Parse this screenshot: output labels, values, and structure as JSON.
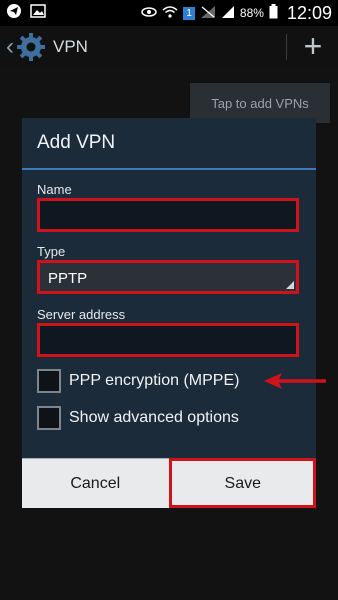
{
  "status_bar": {
    "battery": "88%",
    "time": "12:09",
    "sim_badge": "1"
  },
  "action_bar": {
    "back_icon": "chevron-left-icon",
    "settings_icon": "gear-icon",
    "title": "VPN",
    "add_icon": "plus-icon"
  },
  "tooltip": {
    "text": "Tap to add VPNs"
  },
  "dialog": {
    "title": "Add VPN",
    "fields": {
      "name_label": "Name",
      "name_value": "",
      "type_label": "Type",
      "type_value": "PPTP",
      "server_label": "Server address",
      "server_value": ""
    },
    "options": {
      "ppp_encryption_label": "PPP encryption (MPPE)",
      "ppp_encryption_checked": false,
      "advanced_label": "Show advanced options",
      "advanced_checked": false
    },
    "buttons": {
      "cancel": "Cancel",
      "save": "Save"
    }
  },
  "colors": {
    "highlight": "#d0121b",
    "dialog_bg": "#1c2b3a",
    "accent_line": "#3d7bb6"
  }
}
